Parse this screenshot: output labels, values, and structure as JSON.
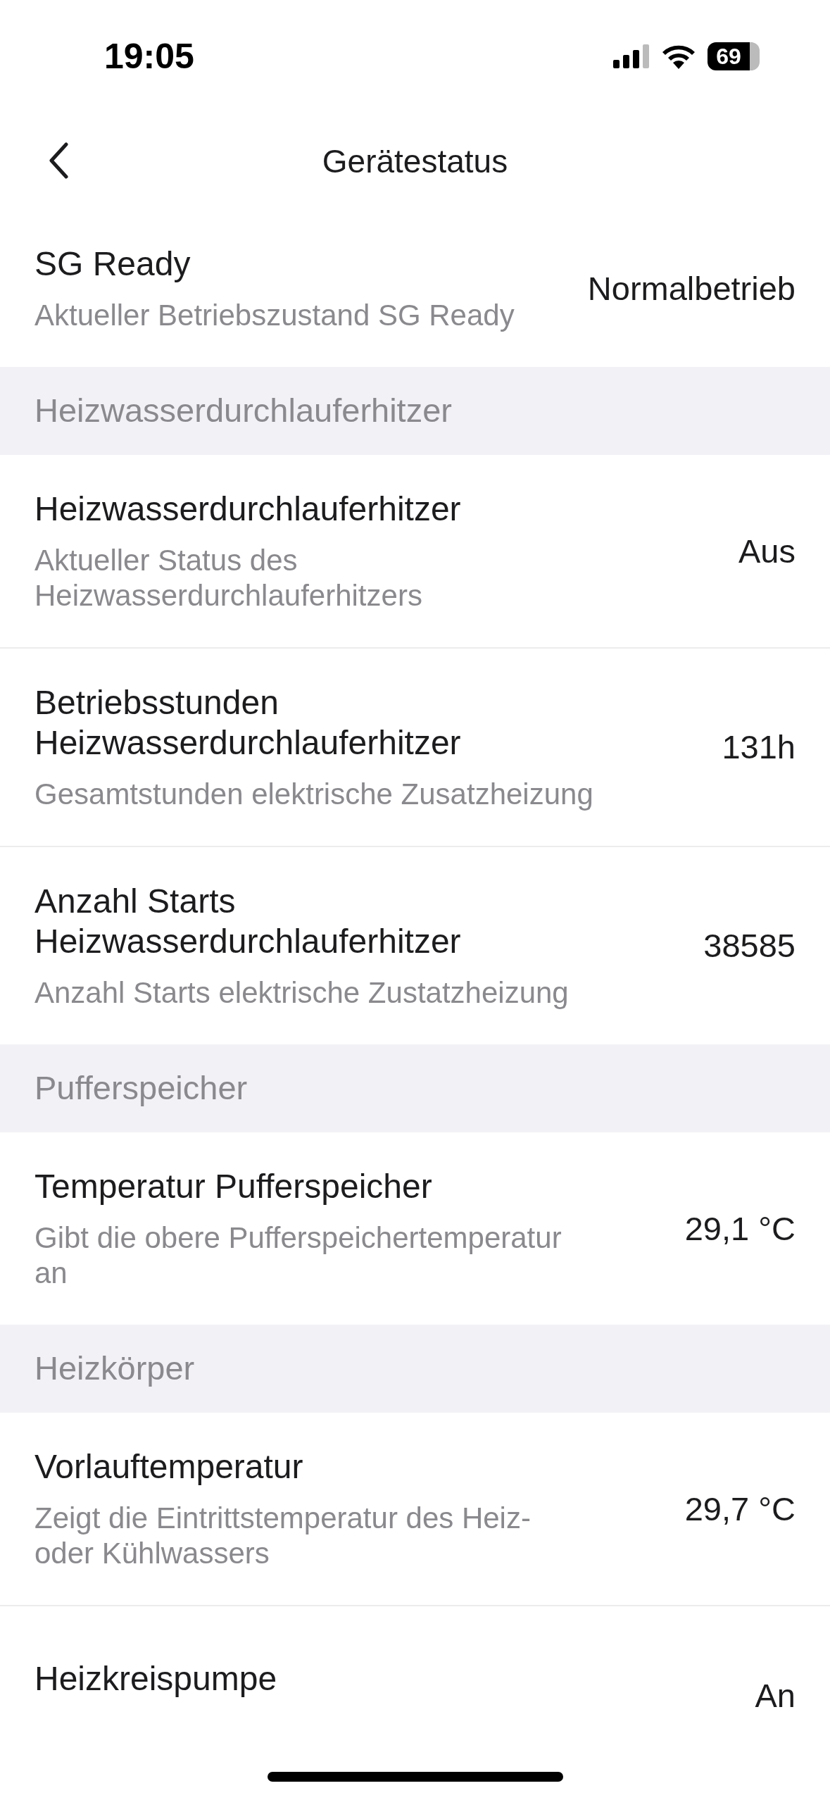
{
  "status_bar": {
    "time": "19:05",
    "battery": "69"
  },
  "nav": {
    "title": "Gerätestatus"
  },
  "sections": [
    {
      "rows": [
        {
          "title": "SG Ready",
          "subtitle": "Aktueller Betriebszustand SG Ready",
          "value": "Normalbetrieb"
        }
      ]
    },
    {
      "header": "Heizwasserdurchlauferhitzer",
      "rows": [
        {
          "title": "Heizwasserdurchlauferhitzer",
          "subtitle": "Aktueller Status des Heizwasserdurchlauferhitzers",
          "value": "Aus"
        },
        {
          "title": "Betriebsstunden Heizwasserdurchlauferhitzer",
          "subtitle": "Gesamtstunden elektrische Zusatzheizung",
          "value": "131h"
        },
        {
          "title": "Anzahl Starts Heizwasserdurchlauferhitzer",
          "subtitle": "Anzahl Starts elektrische Zustatzheizung",
          "value": "38585"
        }
      ]
    },
    {
      "header": "Pufferspeicher",
      "rows": [
        {
          "title": "Temperatur Pufferspeicher",
          "subtitle": "Gibt die obere Pufferspeichertemperatur an",
          "value": "29,1 °C"
        }
      ]
    },
    {
      "header": "Heizkörper",
      "rows": [
        {
          "title": "Vorlauftemperatur",
          "subtitle": "Zeigt die Eintrittstemperatur des Heiz- oder Kühlwassers",
          "value": "29,7 °C"
        },
        {
          "title": "Heizkreispumpe",
          "value": "An"
        }
      ]
    }
  ]
}
